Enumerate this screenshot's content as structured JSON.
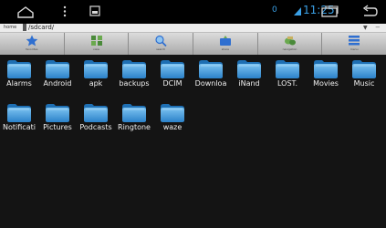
{
  "system_bar": {
    "status_number": "0",
    "clock": "11:25",
    "colors": {
      "accent": "#3aa0e6",
      "icon": "#d8d8d8"
    }
  },
  "path_bar": {
    "home_label": "home",
    "path": "/sdcard/"
  },
  "toolbar": {
    "items": [
      {
        "label": "favorites",
        "icon": "star-icon"
      },
      {
        "label": "view",
        "icon": "grid-icon"
      },
      {
        "label": "search",
        "icon": "search-icon"
      },
      {
        "label": "share",
        "icon": "share-icon"
      },
      {
        "label": "navigation",
        "icon": "tools-icon"
      },
      {
        "label": "menu",
        "icon": "list-icon"
      }
    ]
  },
  "files": [
    {
      "name": "Alarms",
      "icon": "folder-icon"
    },
    {
      "name": "Android",
      "icon": "folder-icon"
    },
    {
      "name": "apk",
      "icon": "folder-icon"
    },
    {
      "name": "backups",
      "icon": "folder-icon"
    },
    {
      "name": "DCIM",
      "icon": "folder-icon"
    },
    {
      "name": "Downloa",
      "icon": "folder-icon"
    },
    {
      "name": "iNand",
      "icon": "folder-icon"
    },
    {
      "name": "LOST.",
      "icon": "folder-icon"
    },
    {
      "name": "Movies",
      "icon": "folder-icon"
    },
    {
      "name": "Music",
      "icon": "folder-icon"
    },
    {
      "name": "Notificati",
      "icon": "folder-icon"
    },
    {
      "name": "Pictures",
      "icon": "folder-icon"
    },
    {
      "name": "Podcasts",
      "icon": "folder-icon"
    },
    {
      "name": "Ringtone",
      "icon": "folder-icon"
    },
    {
      "name": "waze",
      "icon": "folder-icon"
    }
  ],
  "colors": {
    "background": "#141414",
    "folder_top": "#7ec4f2",
    "folder_bottom": "#2b82c9",
    "text": "#f0f0f0"
  }
}
